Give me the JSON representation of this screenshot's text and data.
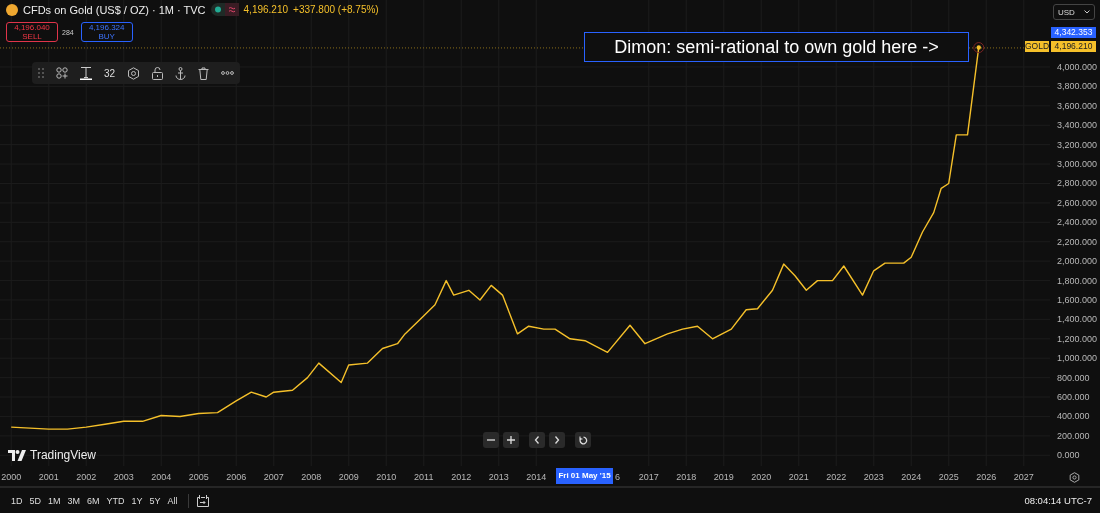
{
  "legend": {
    "title": "CFDs on Gold (US$ / OZ) · 1M · TVC",
    "price": "4,196.210",
    "change": "+337.800 (+8.75%)"
  },
  "trade": {
    "sell_price": "4,196.040",
    "sell_label": "SELL",
    "spread": "284",
    "buy_price": "4,196.324",
    "buy_label": "BUY"
  },
  "drawing_toolbar": {
    "font_size": "32"
  },
  "currency": "USD",
  "annotation": "Dimon: semi-rational to own gold here ->",
  "price_labels": [
    {
      "kind": "marker",
      "text": "4,342.353"
    },
    {
      "kind": "symbol",
      "text": "4,196.210"
    }
  ],
  "crosshair_label": "Fri 01 May '15",
  "covered_tick_fragment": "6",
  "brand": "TradingView",
  "chart_data": {
    "type": "line",
    "x": [
      2000,
      2000.5,
      2001,
      2001.5,
      2002,
      2002.5,
      2003,
      2003.5,
      2004,
      2004.5,
      2005,
      2005.5,
      2006,
      2006.4,
      2006.8,
      2007,
      2007.5,
      2007.9,
      2008.2,
      2008.8,
      2009,
      2009.5,
      2009.9,
      2010.3,
      2010.5,
      2010.9,
      2011.3,
      2011.6,
      2011.8,
      2012.2,
      2012.5,
      2012.8,
      2013.1,
      2013.3,
      2013.5,
      2013.8,
      2014.2,
      2014.5,
      2014.9,
      2015.3,
      2015.9,
      2016.5,
      2016.9,
      2017.5,
      2017.9,
      2018.3,
      2018.7,
      2019.2,
      2019.6,
      2019.9,
      2020.3,
      2020.6,
      2020.9,
      2021.2,
      2021.5,
      2021.9,
      2022.2,
      2022.7,
      2023,
      2023.3,
      2023.8,
      2024,
      2024.3,
      2024.6,
      2024.8,
      2025,
      2025.2,
      2025.5,
      2025.8
    ],
    "xlim": [
      1999.7,
      2027.7
    ],
    "ylim": [
      -100,
      4690
    ],
    "grid": true,
    "ref_lines": [
      {
        "axis": "y",
        "value": 4196.21
      }
    ],
    "series": [
      {
        "name": "GOLD",
        "color": "#f5c02a",
        "values": [
          290,
          280,
          270,
          270,
          290,
          320,
          350,
          350,
          410,
          400,
          430,
          440,
          560,
          650,
          600,
          650,
          670,
          800,
          950,
          750,
          930,
          950,
          1100,
          1150,
          1250,
          1400,
          1550,
          1800,
          1650,
          1700,
          1600,
          1750,
          1650,
          1450,
          1250,
          1330,
          1300,
          1300,
          1200,
          1180,
          1060,
          1340,
          1150,
          1250,
          1300,
          1330,
          1200,
          1300,
          1500,
          1510,
          1700,
          1970,
          1850,
          1700,
          1800,
          1800,
          1950,
          1650,
          1900,
          1980,
          1980,
          2040,
          2300,
          2500,
          2750,
          2800,
          3300,
          3300,
          4200
        ]
      }
    ],
    "xticks": [
      {
        "value": 2000,
        "label": "2000"
      },
      {
        "value": 2001,
        "label": "2001"
      },
      {
        "value": 2002,
        "label": "2002"
      },
      {
        "value": 2003,
        "label": "2003"
      },
      {
        "value": 2004,
        "label": "2004"
      },
      {
        "value": 2005,
        "label": "2005"
      },
      {
        "value": 2006,
        "label": "2006"
      },
      {
        "value": 2007,
        "label": "2007"
      },
      {
        "value": 2008,
        "label": "2008"
      },
      {
        "value": 2009,
        "label": "2009"
      },
      {
        "value": 2010,
        "label": "2010"
      },
      {
        "value": 2011,
        "label": "2011"
      },
      {
        "value": 2012,
        "label": "2012"
      },
      {
        "value": 2013,
        "label": "2013"
      },
      {
        "value": 2014,
        "label": "2014"
      },
      {
        "value": 2017,
        "label": "2017"
      },
      {
        "value": 2018,
        "label": "2018"
      },
      {
        "value": 2019,
        "label": "2019"
      },
      {
        "value": 2020,
        "label": "2020"
      },
      {
        "value": 2021,
        "label": "2021"
      },
      {
        "value": 2022,
        "label": "2022"
      },
      {
        "value": 2023,
        "label": "2023"
      },
      {
        "value": 2024,
        "label": "2024"
      },
      {
        "value": 2025,
        "label": "2025"
      },
      {
        "value": 2026,
        "label": "2026"
      },
      {
        "value": 2027,
        "label": "2027"
      }
    ],
    "yticks": [
      {
        "value": 0,
        "label": "0.000"
      },
      {
        "value": 200,
        "label": "200.000"
      },
      {
        "value": 400,
        "label": "400.000"
      },
      {
        "value": 600,
        "label": "600.000"
      },
      {
        "value": 800,
        "label": "800.000"
      },
      {
        "value": 1000,
        "label": "1,000.000"
      },
      {
        "value": 1200,
        "label": "1,200.000"
      },
      {
        "value": 1400,
        "label": "1,400.000"
      },
      {
        "value": 1600,
        "label": "1,600.000"
      },
      {
        "value": 1800,
        "label": "1,800.000"
      },
      {
        "value": 2000,
        "label": "2,000.000"
      },
      {
        "value": 2200,
        "label": "2,200.000"
      },
      {
        "value": 2400,
        "label": "2,400.000"
      },
      {
        "value": 2600,
        "label": "2,600.000"
      },
      {
        "value": 2800,
        "label": "2,800.000"
      },
      {
        "value": 3000,
        "label": "3,000.000"
      },
      {
        "value": 3200,
        "label": "3,200.000"
      },
      {
        "value": 3400,
        "label": "3,400.000"
      },
      {
        "value": 3600,
        "label": "3,600.000"
      },
      {
        "value": 3800,
        "label": "3,800.000"
      },
      {
        "value": 4000,
        "label": "4,000.000"
      }
    ]
  },
  "periods": [
    "1D",
    "5D",
    "1M",
    "3M",
    "6M",
    "YTD",
    "1Y",
    "5Y",
    "All"
  ],
  "clock": "08:04:14 UTC-7"
}
